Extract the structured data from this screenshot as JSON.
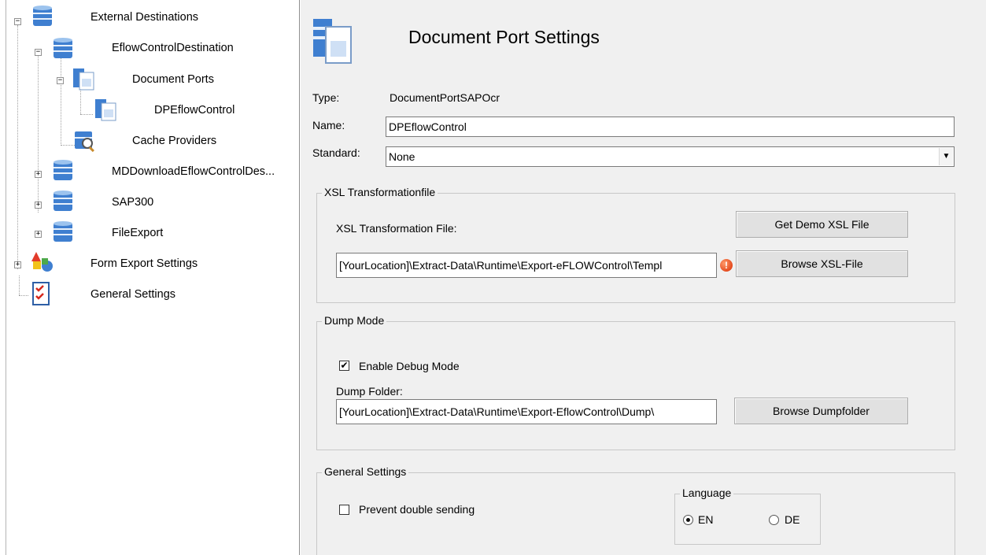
{
  "tree": {
    "nodes": [
      {
        "label": "External Destinations",
        "icon": "database-icon"
      },
      {
        "label": "EflowControlDestination",
        "icon": "database-icon"
      },
      {
        "label": "Document Ports",
        "icon": "document-stack-icon"
      },
      {
        "label": "DPEflowControl",
        "icon": "document-stack-icon"
      },
      {
        "label": "Cache Providers",
        "icon": "cache-search-icon"
      },
      {
        "label": "MDDownloadEflowControlDes...",
        "icon": "database-icon"
      },
      {
        "label": "SAP300",
        "icon": "database-icon"
      },
      {
        "label": "FileExport",
        "icon": "database-icon"
      },
      {
        "label": "Form Export Settings",
        "icon": "shapes-icon"
      },
      {
        "label": "General Settings",
        "icon": "checklist-icon"
      }
    ],
    "expander_minus": "−",
    "expander_plus": "+"
  },
  "header": {
    "title": "Document Port Settings",
    "icon": "document-stack-icon"
  },
  "form": {
    "type_label": "Type:",
    "type_value": "DocumentPortSAPOcr",
    "name_label": "Name:",
    "name_value": "DPEflowControl",
    "standard_label": "Standard:",
    "standard_value": "None"
  },
  "xsl_group": {
    "title": "XSL Transformationfile",
    "file_label": "XSL Transformation File:",
    "file_value": "[YourLocation]\\Extract-Data\\Runtime\\Export-eFLOWControl\\Templ",
    "demo_button": "Get Demo XSL File",
    "browse_button": "Browse XSL-File",
    "warning_glyph": "!"
  },
  "dump_group": {
    "title": "Dump Mode",
    "debug_label": "Enable Debug Mode",
    "debug_checked": true,
    "folder_label": "Dump Folder:",
    "folder_value": "[YourLocation]\\Extract-Data\\Runtime\\Export-EflowControl\\Dump\\",
    "browse_button": "Browse Dumpfolder"
  },
  "general_group": {
    "title": "General Settings",
    "prevent_label": "Prevent double sending",
    "prevent_checked": false,
    "language_title": "Language",
    "lang_en": "EN",
    "lang_de": "DE",
    "selected_language": "EN"
  },
  "colors": {
    "pane_bg": "#f0f0f0",
    "button_bg": "#e1e1e1",
    "db_blue": "#3f7fd0",
    "warning_red": "#d92a00"
  },
  "check_glyph": "✔"
}
